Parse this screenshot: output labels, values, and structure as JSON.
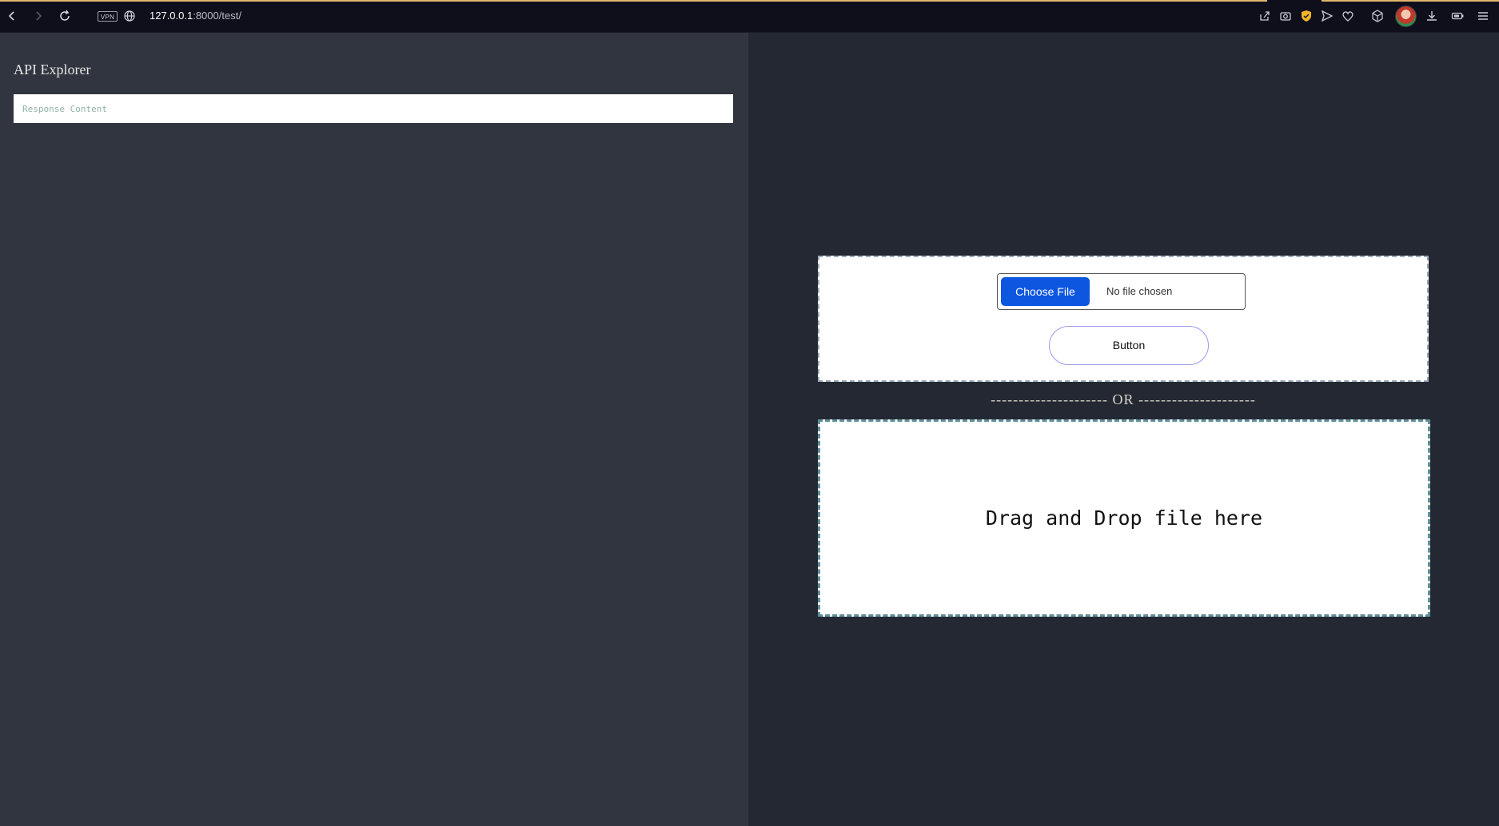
{
  "browser": {
    "vpn_label": "VPN",
    "url_host": "127.0.0.1",
    "url_path": ":8000/test/",
    "icons": [
      "back-icon",
      "forward-icon",
      "reload-icon",
      "globe-icon",
      "share-icon",
      "camera-icon",
      "shield-icon",
      "send-icon",
      "heart-icon",
      "cube-icon",
      "download-icon",
      "battery-icon",
      "menu-icon"
    ]
  },
  "left": {
    "title": "API Explorer",
    "response_placeholder": "Response Content",
    "response_value": ""
  },
  "right": {
    "choose_file_label": "Choose File",
    "no_file_text": "No file chosen",
    "button_label": "Button",
    "or_separator": "---------------------  OR  ---------------------",
    "drop_text": "Drag and Drop file here"
  },
  "colors": {
    "left_bg": "#31353f",
    "right_bg": "#232833",
    "choose_btn": "#0d56e0",
    "accent_line": "#e0b56e"
  }
}
